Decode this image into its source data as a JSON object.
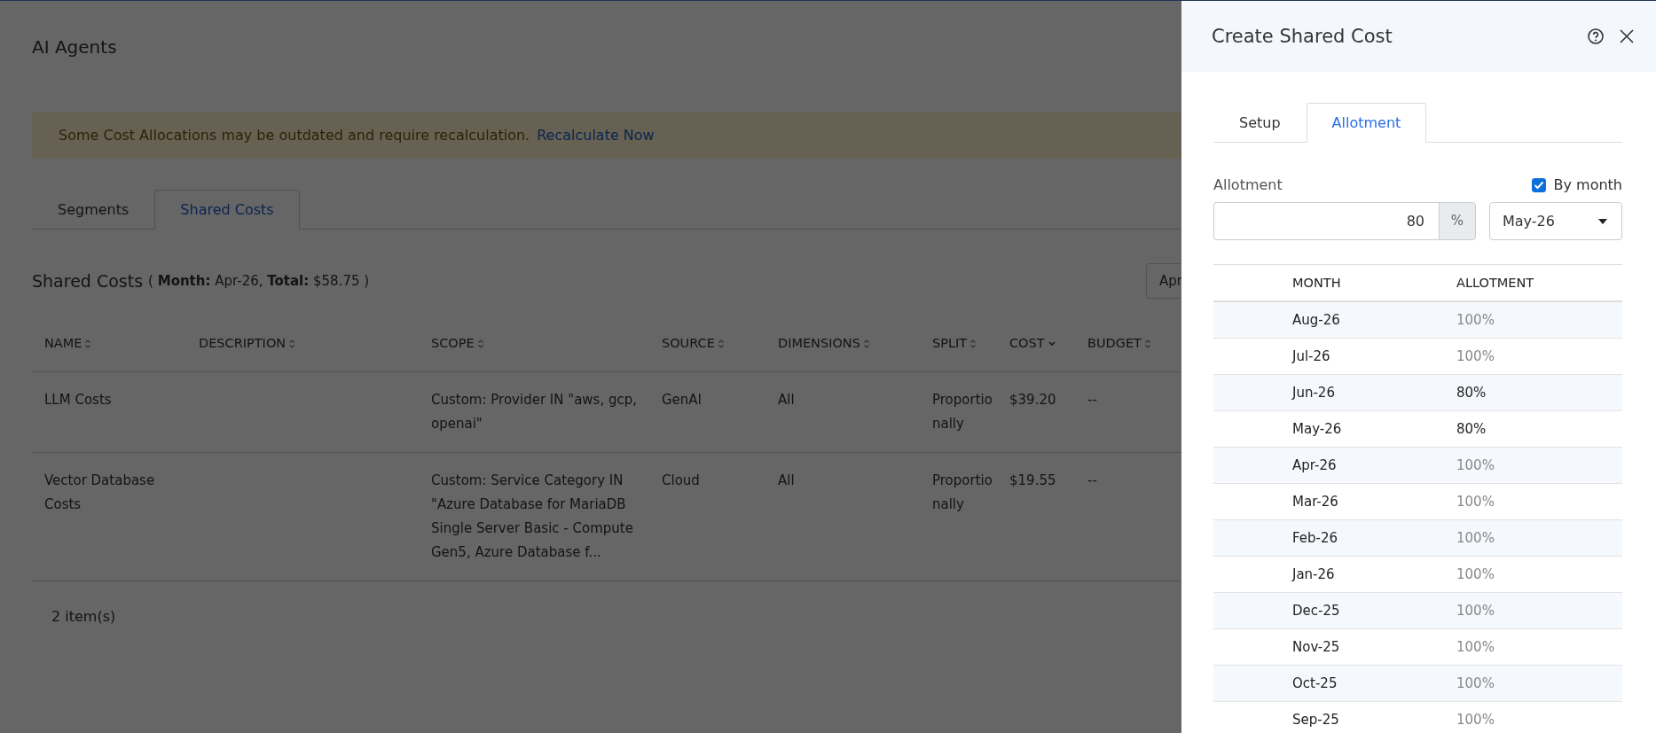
{
  "page": {
    "title": "AI Agents"
  },
  "banner": {
    "message": "Some Cost Allocations may be outdated and require recalculation.",
    "link": "Recalculate Now"
  },
  "tabs": [
    {
      "label": "Segments",
      "selected": false
    },
    {
      "label": "Shared Costs",
      "selected": true
    }
  ],
  "section": {
    "title": "Shared Costs",
    "summary": "( **Month:** Apr-26, **Total:** $58.75 )",
    "date_field": "Apr"
  },
  "table": {
    "columns": [
      {
        "label": "NAME",
        "sorted": false
      },
      {
        "label": "DESCRIPTION",
        "sorted": false
      },
      {
        "label": "SCOPE",
        "sorted": false
      },
      {
        "label": "SOURCE",
        "sorted": false
      },
      {
        "label": "DIMENSIONS",
        "sorted": false
      },
      {
        "label": "SPLIT",
        "sorted": false
      },
      {
        "label": "COST",
        "sorted": true
      },
      {
        "label": "BUDGET",
        "sorted": false
      }
    ],
    "rows": [
      [
        "LLM Costs",
        "",
        "Custom: Provider IN \"aws, gcp, openai\"",
        "GenAI",
        "All",
        "Proportionally",
        "$39.20",
        "--"
      ],
      [
        "Vector Database Costs",
        "",
        "Custom: Service Category IN \"Azure Database for MariaDB Single Server Basic - Compute Gen5, Azure Database f...",
        "Cloud",
        "All",
        "Proportionally",
        "$19.55",
        "--"
      ]
    ],
    "footer": "2 item(s)"
  },
  "panel": {
    "title": "Create Shared Cost",
    "tabs": [
      {
        "label": "Setup",
        "selected": false
      },
      {
        "label": "Allotment",
        "selected": true
      }
    ],
    "allotment_label": "Allotment",
    "by_month": {
      "label": "By month",
      "checked": true
    },
    "allotment_value": "80",
    "unit": "%",
    "month_select": "May-26",
    "columns": [
      "MONTH",
      "ALLOTMENT"
    ],
    "rows": [
      {
        "month": "Aug-26",
        "allotment": "100%",
        "custom": false
      },
      {
        "month": "Jul-26",
        "allotment": "100%",
        "custom": false
      },
      {
        "month": "Jun-26",
        "allotment": "80%",
        "custom": true
      },
      {
        "month": "May-26",
        "allotment": "80%",
        "custom": true
      },
      {
        "month": "Apr-26",
        "allotment": "100%",
        "custom": false
      },
      {
        "month": "Mar-26",
        "allotment": "100%",
        "custom": false
      },
      {
        "month": "Feb-26",
        "allotment": "100%",
        "custom": false
      },
      {
        "month": "Jan-26",
        "allotment": "100%",
        "custom": false
      },
      {
        "month": "Dec-25",
        "allotment": "100%",
        "custom": false
      },
      {
        "month": "Nov-25",
        "allotment": "100%",
        "custom": false
      },
      {
        "month": "Oct-25",
        "allotment": "100%",
        "custom": false
      },
      {
        "month": "Sep-25",
        "allotment": "100%",
        "custom": false
      }
    ]
  }
}
